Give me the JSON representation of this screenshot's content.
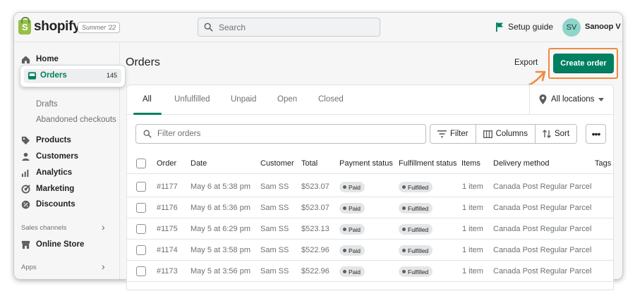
{
  "brand": {
    "logo_text": "shopify",
    "edition": "Summer '22"
  },
  "topbar": {
    "search_placeholder": "Search",
    "setup_guide": "Setup guide",
    "avatar_initials": "SV",
    "user_name": "Sanoop V"
  },
  "sidebar": {
    "home": "Home",
    "orders": "Orders",
    "orders_count": "145",
    "drafts": "Drafts",
    "abandoned": "Abandoned checkouts",
    "products": "Products",
    "customers": "Customers",
    "analytics": "Analytics",
    "marketing": "Marketing",
    "discounts": "Discounts",
    "sales_channels": "Sales channels",
    "online_store": "Online Store",
    "apps": "Apps"
  },
  "page": {
    "title": "Orders",
    "export": "Export",
    "create_order": "Create order"
  },
  "tabs": [
    "All",
    "Unfulfilled",
    "Unpaid",
    "Open",
    "Closed"
  ],
  "locations_label": "All locations",
  "toolbar": {
    "filter_placeholder": "Filter orders",
    "filter": "Filter",
    "columns": "Columns",
    "sort": "Sort",
    "more": "•••"
  },
  "table": {
    "headers": [
      "Order",
      "Date",
      "Customer",
      "Total",
      "Payment status",
      "Fulfillment status",
      "Items",
      "Delivery method",
      "Tags"
    ],
    "rows": [
      {
        "order": "#1177",
        "date": "May 6 at 5:38 pm",
        "customer": "Sam SS",
        "total": "$523.07",
        "payment": "Paid",
        "fulfillment": "Fulfilled",
        "items": "1 item",
        "delivery": "Canada Post Regular Parcel"
      },
      {
        "order": "#1176",
        "date": "May 6 at 5:36 pm",
        "customer": "Sam SS",
        "total": "$523.07",
        "payment": "Paid",
        "fulfillment": "Fulfilled",
        "items": "1 item",
        "delivery": "Canada Post Regular Parcel"
      },
      {
        "order": "#1175",
        "date": "May 5 at 6:29 pm",
        "customer": "Sam SS",
        "total": "$523.13",
        "payment": "Paid",
        "fulfillment": "Fulfilled",
        "items": "1 item",
        "delivery": "Canada Post Regular Parcel"
      },
      {
        "order": "#1174",
        "date": "May 5 at 3:58 pm",
        "customer": "Sam SS",
        "total": "$522.96",
        "payment": "Paid",
        "fulfillment": "Fulfilled",
        "items": "1 item",
        "delivery": "Canada Post Regular Parcel"
      },
      {
        "order": "#1173",
        "date": "May 5 at 3:56 pm",
        "customer": "Sam SS",
        "total": "$522.96",
        "payment": "Paid",
        "fulfillment": "Fulfilled",
        "items": "1 item",
        "delivery": "Canada Post Regular Parcel"
      }
    ]
  },
  "colors": {
    "accent": "#008060",
    "highlight": "#f08a3c",
    "active_text": "#007f5f"
  },
  "icons": [
    "search-icon",
    "flag-icon",
    "home-icon",
    "inbox-icon",
    "tag-icon",
    "person-icon",
    "bar-chart-icon",
    "megaphone-icon",
    "discount-icon",
    "store-icon",
    "chevron-right-icon",
    "location-pin-icon",
    "caret-down-icon",
    "filter-lines-icon",
    "columns-icon",
    "sort-arrows-icon",
    "more-dots-icon"
  ]
}
